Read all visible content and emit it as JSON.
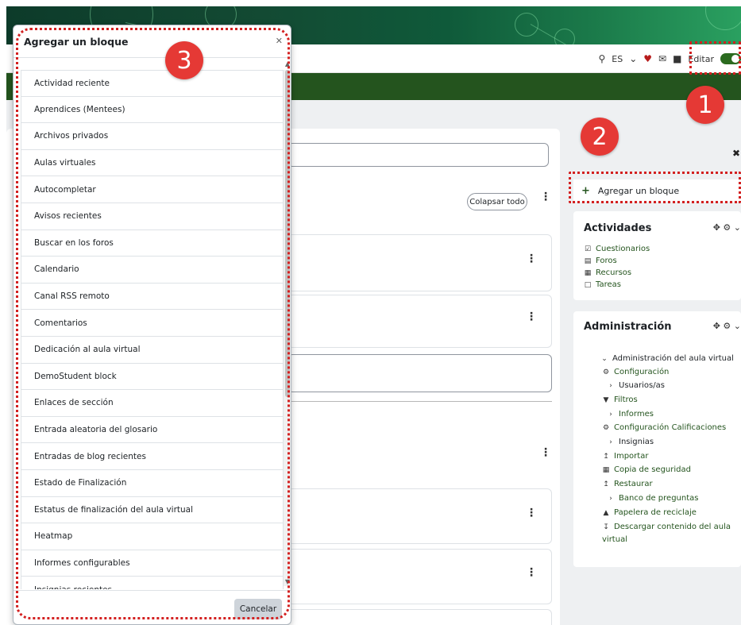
{
  "topbar": {
    "language": "ES",
    "edit_label": "Editar"
  },
  "course": {
    "collapse_all": "Colapsar todo"
  },
  "right_column": {
    "add_block": "Agregar un bloque",
    "activities": {
      "title": "Actividades",
      "items": [
        "Cuestionarios",
        "Foros",
        "Recursos",
        "Tareas"
      ]
    },
    "admin": {
      "title": "Administración",
      "items": [
        "Administración del aula virtual",
        "Configuración",
        "Usuarios/as",
        "Filtros",
        "Informes",
        "Configuración Calificaciones",
        "Insignias",
        "Importar",
        "Copia de seguridad",
        "Restaurar",
        "Banco de preguntas",
        "Papelera de reciclaje",
        "Descargar contenido del aula",
        "virtual"
      ]
    }
  },
  "modal": {
    "title": "Agregar un bloque",
    "items": [
      "Actividad reciente",
      "Aprendices (Mentees)",
      "Archivos privados",
      "Aulas virtuales",
      "Autocompletar",
      "Avisos recientes",
      "Buscar en los foros",
      "Calendario",
      "Canal RSS remoto",
      "Comentarios",
      "Dedicación al aula virtual",
      "DemoStudent block",
      "Enlaces de sección",
      "Entrada aleatoria del glosario",
      "Entradas de blog recientes",
      "Estado de Finalización",
      "Estatus de finalización del aula virtual",
      "Heatmap",
      "Informes configurables",
      "Insignias recientes"
    ],
    "cancel": "Cancelar"
  },
  "annotations": {
    "badge1": "1",
    "badge2": "2",
    "badge3": "3"
  },
  "colors": {
    "brand_green": "#24541e",
    "annotation_red": "#e53935"
  }
}
